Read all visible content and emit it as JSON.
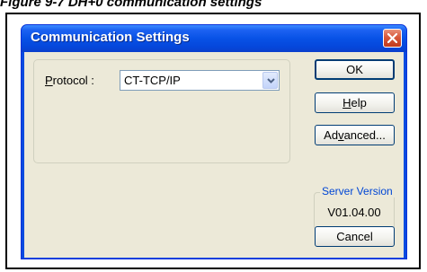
{
  "caption": "Figure 9-7  DH+0 communication settings",
  "window": {
    "title": "Communication Settings"
  },
  "protocol": {
    "label_accel": "P",
    "label_rest": "rotocol :",
    "selected_value": "CT-TCP/IP"
  },
  "buttons": {
    "ok_label": "OK",
    "help_accel": "H",
    "help_rest": "elp",
    "advanced_pre": "Ad",
    "advanced_accel": "v",
    "advanced_post": "anced...",
    "cancel_label": "Cancel"
  },
  "server_version": {
    "legend": "Server Version",
    "value": "V01.04.00"
  },
  "icons": {
    "close": "close-icon",
    "dropdown": "chevron-down-icon"
  },
  "colors": {
    "titlebar": "#0852e6",
    "client_bg": "#ece9d8",
    "close_button": "#d8583a",
    "legend_text": "#0046d5"
  }
}
